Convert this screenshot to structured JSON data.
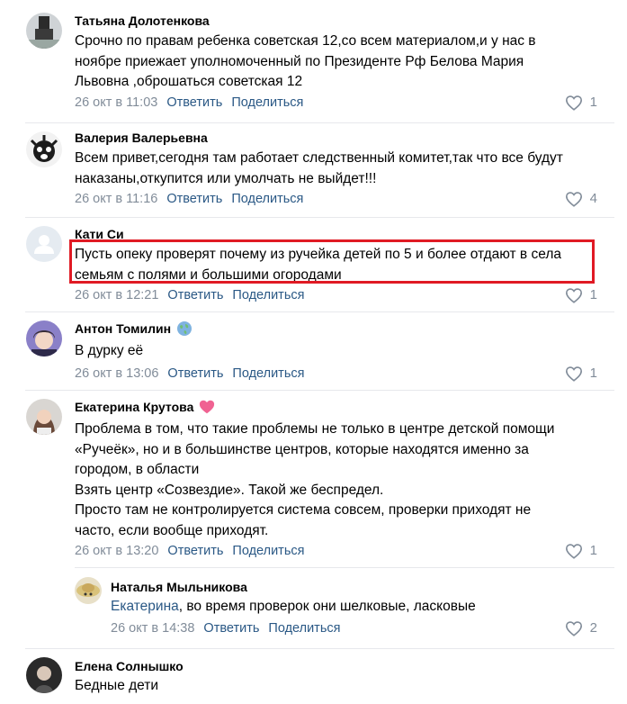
{
  "comments": [
    {
      "author": "Татьяна Долотенкова",
      "lines": [
        "Срочно по правам ребенка советская 12,со всем материалом,и у нас в",
        "ноябре приежает уполномоченный по Президенте Рф Белова Мария",
        "Львовна ,оброшаться советская 12"
      ],
      "date": "26 окт в 11:03",
      "reply": "Ответить",
      "share": "Поделиться",
      "likes": "1"
    },
    {
      "author": "Валерия Валерьевна",
      "lines": [
        "Всем привет,сегодня там работает следственный комитет,так что все будут",
        "наказаны,откупится или умолчать не выйдет!!!"
      ],
      "date": "26 окт в 11:16",
      "reply": "Ответить",
      "share": "Поделиться",
      "likes": "4"
    },
    {
      "author": "Кати Си",
      "lines": [
        "Пусть опеку проверят почему из ручейка детей по 5 и более отдают в села",
        "семьям с полями и большими огородами"
      ],
      "date": "26 окт в 12:21",
      "reply": "Ответить",
      "share": "Поделиться",
      "likes": "1"
    },
    {
      "author": "Антон Томилин",
      "lines": [
        "В дурку её"
      ],
      "date": "26 окт в 13:06",
      "reply": "Ответить",
      "share": "Поделиться",
      "likes": "1"
    },
    {
      "author": "Екатерина Крутова",
      "lines": [
        "Проблема в том, что такие проблемы не только в центре детской помощи",
        "«Ручеёк», но и в большинстве центров, которые находятся именно за",
        "городом, в области",
        "Взять центр «Созвездие». Такой же беспредел.",
        "Просто там не контролируется система совсем, проверки приходят не",
        "часто, если вообще приходят."
      ],
      "date": "26 окт в 13:20",
      "reply": "Ответить",
      "share": "Поделиться",
      "likes": "1"
    },
    {
      "author": "Наталья Мыльникова",
      "mention": "Екатерина",
      "text_after_mention": ", во время проверок они шелковые, ласковые",
      "date": "26 окт в 14:38",
      "reply": "Ответить",
      "share": "Поделиться",
      "likes": "2"
    },
    {
      "author": "Елена Солнышко",
      "lines": [
        "Бедные дети"
      ],
      "date": "",
      "reply": "",
      "share": "",
      "likes": ""
    }
  ],
  "icons": {
    "like": "heart-outline-icon",
    "globe_badge": "globe-emoji-icon",
    "heart_badge": "pink-heart-emoji-icon"
  },
  "colors": {
    "link": "#2a5885",
    "meta": "#818c99",
    "separator": "#e7e8ec",
    "highlight": "#e01a24",
    "heart_badge": "#f06292"
  }
}
